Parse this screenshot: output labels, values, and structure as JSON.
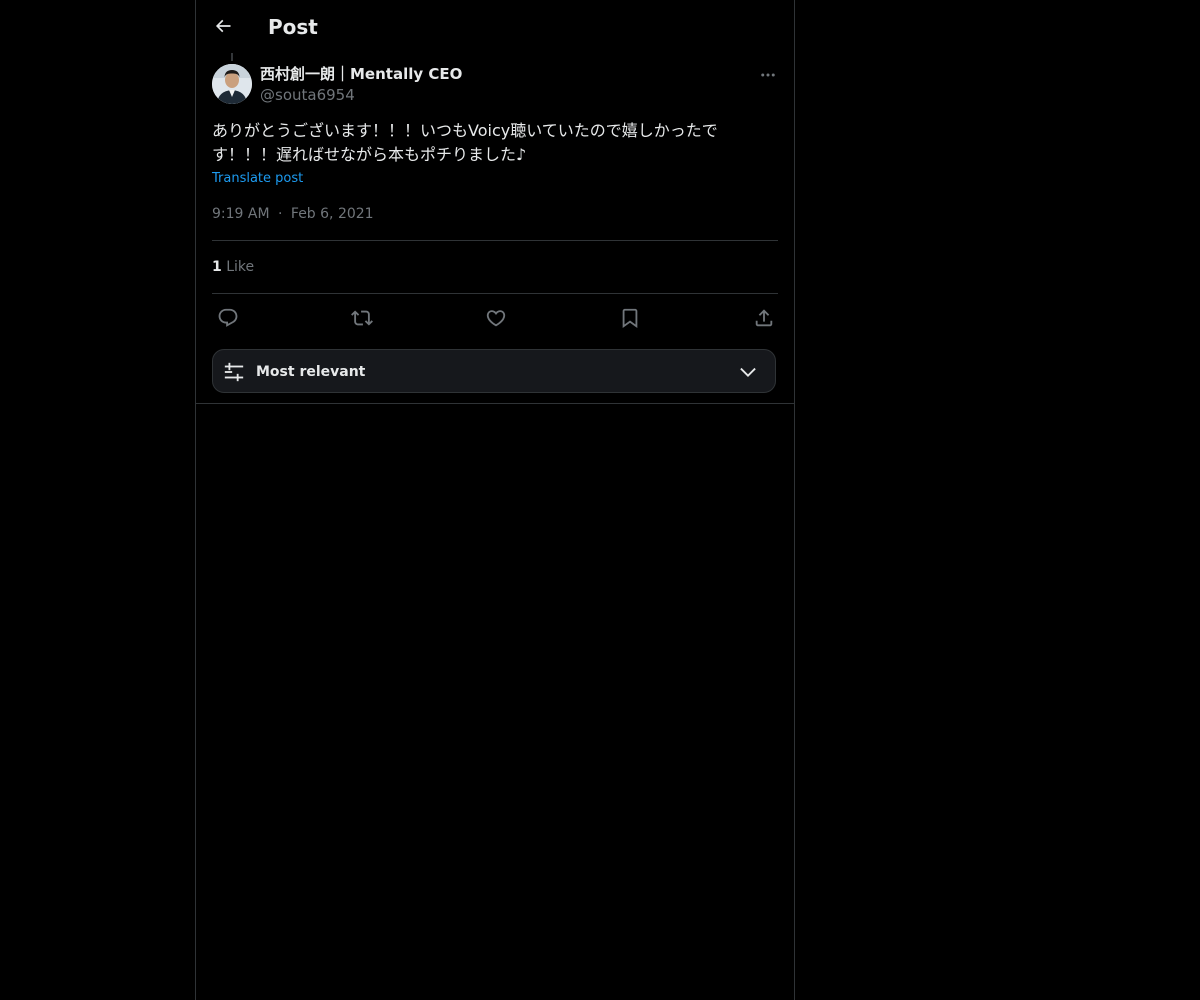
{
  "header": {
    "title": "Post",
    "back_icon": "arrow-left-icon"
  },
  "post": {
    "author": {
      "name": "西村創一朗｜Mentally CEO",
      "handle": "@souta6954",
      "avatar_icon": "avatar-photo"
    },
    "text": "ありがとうございます！！！いつもVoicy聴いていたので嬉しかったです！！！遅ればせながら本もポチりました♪",
    "translate_label": "Translate post",
    "time": "9:19 AM",
    "separator": "·",
    "date": "Feb 6, 2021",
    "likes_count": "1",
    "likes_label": "Like"
  },
  "actions": {
    "reply_icon": "reply-icon",
    "repost_icon": "repost-icon",
    "like_icon": "heart-icon",
    "bookmark_icon": "bookmark-icon",
    "share_icon": "share-icon",
    "more_icon": "more-horizontal-icon"
  },
  "sort": {
    "label": "Most relevant",
    "icon": "sliders-icon",
    "chevron": "chevron-down-icon"
  },
  "colors": {
    "background": "#000000",
    "text": "#e7e9ea",
    "muted": "#71767b",
    "link": "#1d9bf0",
    "border": "#2f3336",
    "sort_bg": "#16181c"
  }
}
